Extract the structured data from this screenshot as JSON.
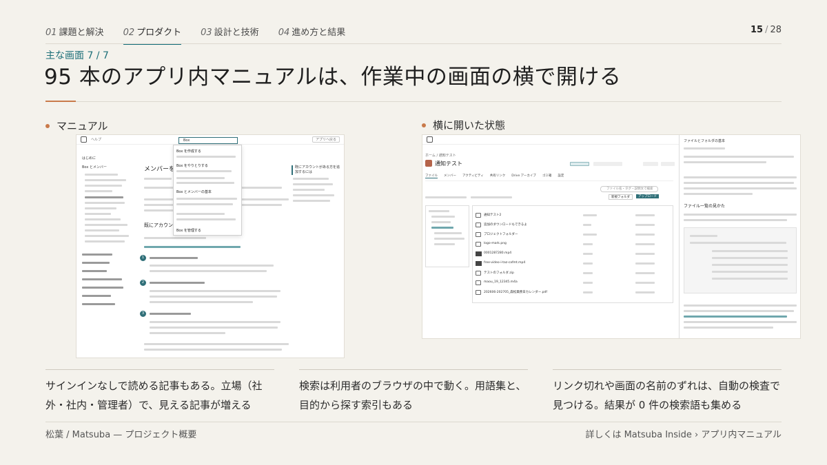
{
  "nav": {
    "tabs": [
      {
        "num": "01",
        "label": "課題と解決",
        "active": false
      },
      {
        "num": "02",
        "label": "プロダクト",
        "active": true
      },
      {
        "num": "03",
        "label": "設計と技術",
        "active": false
      },
      {
        "num": "04",
        "label": "進め方と結果",
        "active": false
      }
    ],
    "page_current": "15",
    "page_sep": "/",
    "page_total": "28"
  },
  "heading": {
    "eyebrow": "主な画面 7 / 7",
    "title": "95 本のアプリ内マニュアルは、作業中の画面の横で開ける"
  },
  "left_section": {
    "label": "マニュアル",
    "screenshot": {
      "app_title": "ヘルプ",
      "search_value": "Box",
      "open_app_label": "アプリへ戻る",
      "sidebar_heading": "はじめに",
      "group_heading": "Box とメンバー",
      "page_heading": "メンバーを",
      "section_heading": "既にアカウン",
      "popup_items": [
        "Box を作成する",
        "Box をやりとりする",
        "Box とメンバーの基本",
        "Box を管理する"
      ],
      "toc_heading": "既にアカウントがある方を追加するには"
    },
    "caption": "サインインなしで読める記事もある。立場（社外・社内・管理者）で、見える記事が増える"
  },
  "right_section": {
    "label": "横に開いた状態",
    "screenshot": {
      "breadcrumb": "ホーム / 通知テスト",
      "folder_title": "通知テスト",
      "tabs": [
        "ファイル",
        "メンバー",
        "アクティビティ",
        "共有リンク",
        "Drive アーカイブ",
        "ゴミ箱",
        "設定"
      ],
      "search_placeholder": "ファイル名・タグ・説明文で検索",
      "new_folder_label": "新規フォルダ",
      "upload_label": "アップロード",
      "files": [
        "通知テスト2",
        "追加のダウンロードもできるよ",
        "プロジェクトフォルダー",
        "logo-mark.png",
        "0001287280.mp4",
        "free-video-i-taz-cafmt.mp4",
        "テストのフォルダ.zip",
        "maou_19_12345.m4a",
        "202606-202705_森松業務日カレンダー.pdf"
      ],
      "panel_title": "ファイルとフォルダの基本",
      "panel_heading": "ファイル一覧の見かた"
    },
    "caption_1": "検索は利用者のブラウザの中で動く。用語集と、目的から探す索引もある",
    "caption_2": "リンク切れや画面の名前のずれは、自動の検査で見つける。結果が 0 件の検索語も集める"
  },
  "footer": {
    "left": "松葉 / Matsuba — プロジェクト概要",
    "right": "詳しくは Matsuba Inside › アプリ内マニュアル"
  },
  "colors": {
    "accent_teal": "#0f6b78",
    "accent_orange": "#c97a4a",
    "background": "#f4f2ec"
  }
}
